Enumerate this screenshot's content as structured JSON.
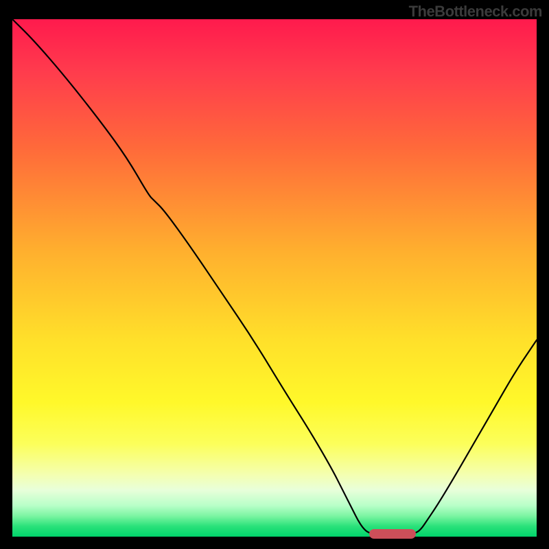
{
  "watermark": "TheBottleneck.com",
  "chart_data": {
    "type": "line",
    "title": "",
    "xlabel": "",
    "ylabel": "",
    "x_range": [
      0,
      100
    ],
    "y_range": [
      0,
      100
    ],
    "curve_points": [
      {
        "x": 0,
        "y": 100
      },
      {
        "x": 4,
        "y": 96
      },
      {
        "x": 10,
        "y": 89
      },
      {
        "x": 17,
        "y": 80
      },
      {
        "x": 22,
        "y": 73
      },
      {
        "x": 26,
        "y": 66
      },
      {
        "x": 27,
        "y": 65
      },
      {
        "x": 29,
        "y": 63
      },
      {
        "x": 34,
        "y": 56
      },
      {
        "x": 40,
        "y": 47
      },
      {
        "x": 46,
        "y": 38
      },
      {
        "x": 52,
        "y": 28
      },
      {
        "x": 57,
        "y": 20
      },
      {
        "x": 61,
        "y": 13
      },
      {
        "x": 63,
        "y": 9
      },
      {
        "x": 65,
        "y": 5
      },
      {
        "x": 66,
        "y": 3
      },
      {
        "x": 67,
        "y": 1.5
      },
      {
        "x": 68,
        "y": 0.7
      },
      {
        "x": 70,
        "y": 0.3
      },
      {
        "x": 75,
        "y": 0.3
      },
      {
        "x": 77,
        "y": 0.7
      },
      {
        "x": 78,
        "y": 1.5
      },
      {
        "x": 79,
        "y": 3
      },
      {
        "x": 81,
        "y": 6
      },
      {
        "x": 84,
        "y": 11
      },
      {
        "x": 88,
        "y": 18
      },
      {
        "x": 92,
        "y": 25
      },
      {
        "x": 96,
        "y": 32
      },
      {
        "x": 100,
        "y": 38
      }
    ],
    "optimal_marker": {
      "x_start": 68,
      "x_end": 77,
      "y": 0.5
    },
    "gradient_description": "red (top, high bottleneck) to green (bottom, no bottleneck)"
  }
}
